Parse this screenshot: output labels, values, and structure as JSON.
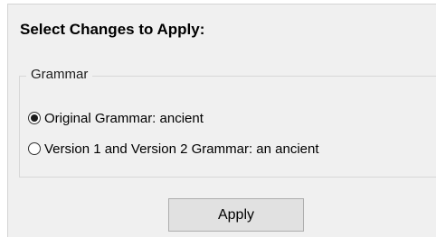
{
  "panel": {
    "title": "Select Changes to Apply:"
  },
  "grammar_group": {
    "legend": "Grammar",
    "options": [
      {
        "label": "Original Grammar: ancient",
        "checked": true
      },
      {
        "label": "Version 1 and Version 2 Grammar: an ancient",
        "checked": false
      }
    ]
  },
  "actions": {
    "apply_label": "Apply"
  },
  "colors": {
    "panel_background": "#f0f0f0",
    "button_background": "#e1e1e1",
    "button_border": "#adadad"
  }
}
